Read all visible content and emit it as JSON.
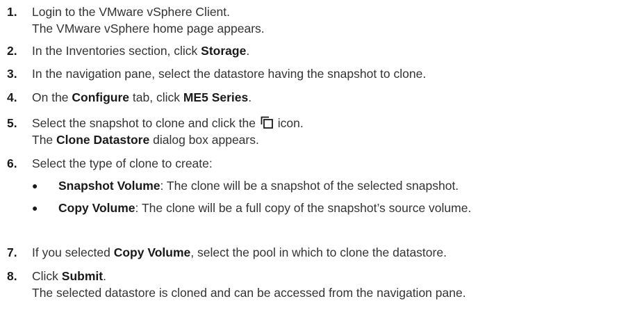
{
  "steps": [
    {
      "number": "1.",
      "text": "Login to the VMware vSphere Client.",
      "result": "The VMware vSphere home page appears."
    },
    {
      "number": "2.",
      "pre": "In the Inventories section, click ",
      "bold": "Storage",
      "post": "."
    },
    {
      "number": "3.",
      "text": "In the navigation pane, select the datastore having the snapshot to clone."
    },
    {
      "number": "4.",
      "pre": "On the ",
      "bold1": "Configure",
      "mid": " tab, click ",
      "bold2": "ME5 Series",
      "post": "."
    },
    {
      "number": "5.",
      "pre": "Select the snapshot to clone and click the ",
      "icon": "clone-icon",
      "post": " icon.",
      "result_pre": "The ",
      "result_bold": "Clone Datastore",
      "result_post": " dialog box appears."
    },
    {
      "number": "6.",
      "text": "Select the type of clone to create:",
      "bullets": [
        {
          "bullet": "●",
          "bold": "Snapshot Volume",
          "text": ": The clone will be a snapshot of the selected snapshot."
        },
        {
          "bullet": "●",
          "bold": "Copy Volume",
          "text": ": The clone will be a full copy of the snapshot’s source volume."
        }
      ]
    },
    {
      "number": "7.",
      "pre": "If you selected ",
      "bold": "Copy Volume",
      "post": ", select the pool in which to clone the datastore."
    },
    {
      "number": "8.",
      "pre": "Click ",
      "bold": "Submit",
      "post": ".",
      "result": "The selected datastore is cloned and can be accessed from the navigation pane."
    }
  ]
}
